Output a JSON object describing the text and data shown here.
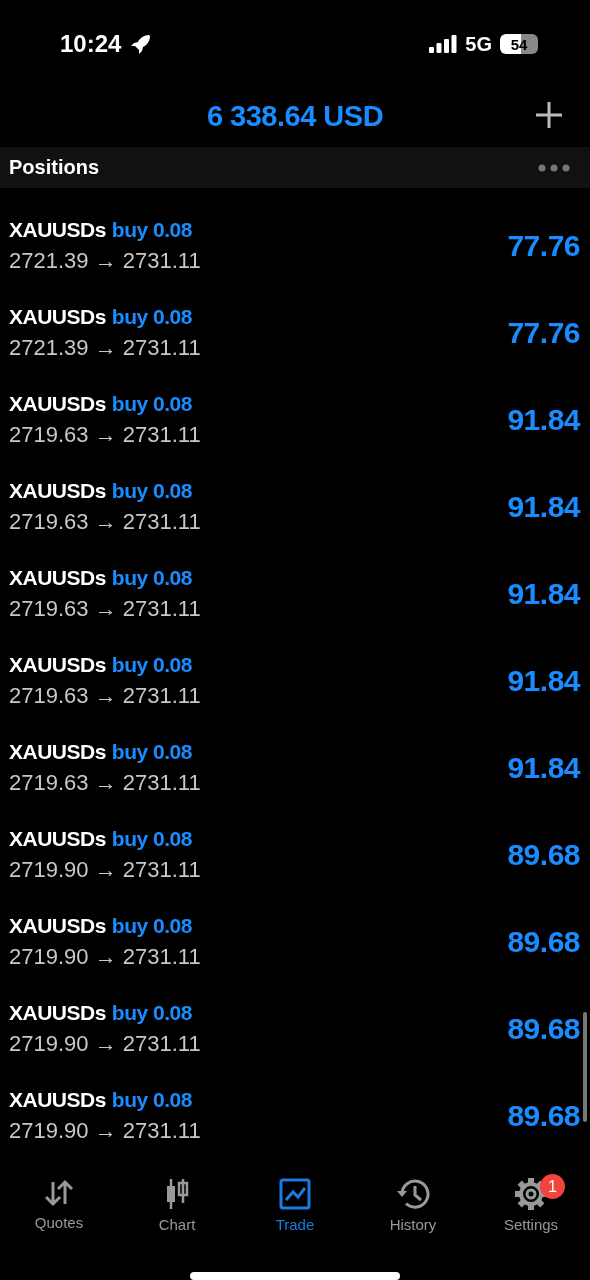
{
  "status_bar": {
    "time": "10:24",
    "network": "5G",
    "battery": "54"
  },
  "header": {
    "balance": "6 338.64 USD"
  },
  "section": {
    "title": "Positions"
  },
  "positions": [
    {
      "symbol": "XAUUSDs",
      "order": "buy 0.08",
      "prices": "2721.39 → 2731.11",
      "profit": "77.76"
    },
    {
      "symbol": "XAUUSDs",
      "order": "buy 0.08",
      "prices": "2721.39 → 2731.11",
      "profit": "77.76"
    },
    {
      "symbol": "XAUUSDs",
      "order": "buy 0.08",
      "prices": "2719.63 → 2731.11",
      "profit": "91.84"
    },
    {
      "symbol": "XAUUSDs",
      "order": "buy 0.08",
      "prices": "2719.63 → 2731.11",
      "profit": "91.84"
    },
    {
      "symbol": "XAUUSDs",
      "order": "buy 0.08",
      "prices": "2719.63 → 2731.11",
      "profit": "91.84"
    },
    {
      "symbol": "XAUUSDs",
      "order": "buy 0.08",
      "prices": "2719.63 → 2731.11",
      "profit": "91.84"
    },
    {
      "symbol": "XAUUSDs",
      "order": "buy 0.08",
      "prices": "2719.63 → 2731.11",
      "profit": "91.84"
    },
    {
      "symbol": "XAUUSDs",
      "order": "buy 0.08",
      "prices": "2719.90 → 2731.11",
      "profit": "89.68"
    },
    {
      "symbol": "XAUUSDs",
      "order": "buy 0.08",
      "prices": "2719.90 → 2731.11",
      "profit": "89.68"
    },
    {
      "symbol": "XAUUSDs",
      "order": "buy 0.08",
      "prices": "2719.90 → 2731.11",
      "profit": "89.68"
    },
    {
      "symbol": "XAUUSDs",
      "order": "buy 0.08",
      "prices": "2719.90 → 2731.11",
      "profit": "89.68"
    }
  ],
  "tab_bar": [
    {
      "kind": "quotes",
      "label": "Quotes",
      "selected": false
    },
    {
      "kind": "chart",
      "label": "Chart",
      "selected": false
    },
    {
      "kind": "trade",
      "label": "Trade",
      "selected": true
    },
    {
      "kind": "history",
      "label": "History",
      "selected": false
    },
    {
      "kind": "settings",
      "label": "Settings",
      "selected": false,
      "badge": "1"
    }
  ]
}
